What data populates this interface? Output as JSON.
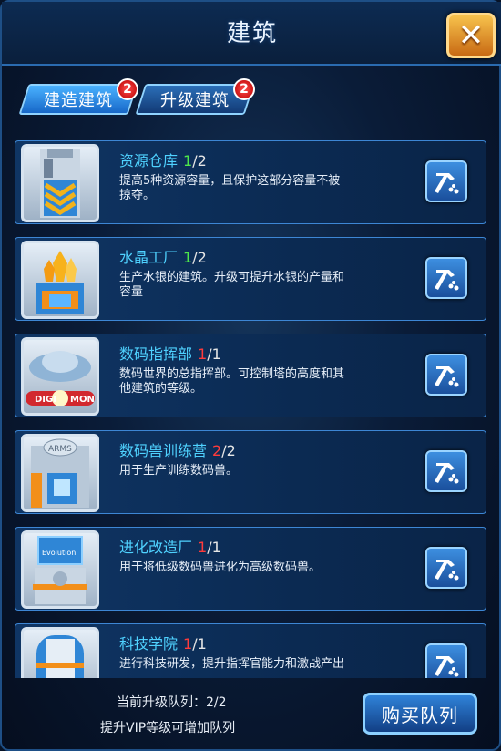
{
  "header": {
    "title": "建筑",
    "close_icon": "close-icon"
  },
  "tabs": [
    {
      "label": "建造建筑",
      "badge": "2",
      "active": true
    },
    {
      "label": "升级建筑",
      "badge": "2",
      "active": false
    }
  ],
  "buildings": [
    {
      "name": "资源仓库",
      "level": "1",
      "max": "/2",
      "level_color": "#4ee84a",
      "desc": "提高5种资源容量，且保护这部分容量不被掠夺。",
      "icon": "warehouse-icon"
    },
    {
      "name": "水晶工厂",
      "level": "1",
      "max": "/2",
      "level_color": "#4ee84a",
      "desc": "生产水银的建筑。升级可提升水银的产量和容量",
      "icon": "crystal-factory-icon"
    },
    {
      "name": "数码指挥部",
      "level": "1",
      "max": "/1",
      "level_color": "#ff3b3b",
      "desc": "数码世界的总指挥部。可控制塔的高度和其他建筑的等级。",
      "icon": "digimon-hq-icon"
    },
    {
      "name": "数码兽训练营",
      "level": "2",
      "max": "/2",
      "level_color": "#ff3b3b",
      "desc": "用于生产训练数码兽。",
      "icon": "training-camp-icon"
    },
    {
      "name": "进化改造厂",
      "level": "1",
      "max": "/1",
      "level_color": "#ff3b3b",
      "desc": "用于将低级数码兽进化为高级数码兽。",
      "icon": "evolution-factory-icon"
    },
    {
      "name": "科技学院",
      "level": "1",
      "max": "/1",
      "level_color": "#ff3b3b",
      "desc": "进行科技研发，提升指挥官能力和激战产出",
      "icon": "tech-academy-icon"
    }
  ],
  "thumb_labels": {
    "digi": "DIGI",
    "mon": "MON",
    "arms": "ARMS",
    "evolution": "Evolution"
  },
  "footer": {
    "queue_label": "当前升级队列：2/2",
    "vip_hint": "提升VIP等级可增加队列",
    "buy_button": "购买队列"
  }
}
